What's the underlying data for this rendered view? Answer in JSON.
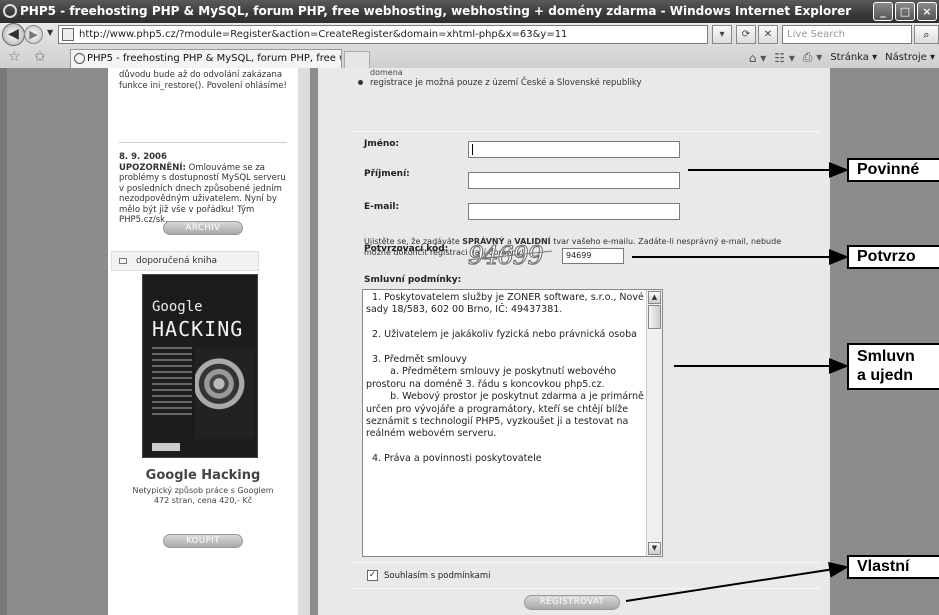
{
  "window": {
    "title": "PHP5 - freehosting PHP & MySQL, forum PHP, free webhosting, webhosting + domény zdarma - Windows Internet Explorer",
    "controls": [
      "_",
      "□",
      "×"
    ]
  },
  "navbar": {
    "url": "http://www.php5.cz/?module=Register&action=CreateRegister&domain=xhtml-php&x=63&y=11",
    "search_placeholder": "Live Search",
    "tab_title": "PHP5 - freehosting PHP & MySQL, forum PHP, free we...",
    "commands": {
      "home": "⌂ ▾",
      "feeds": "☷ ▾",
      "print": "⎙ ▾",
      "page": "Stránka ▾",
      "tools": "Nástroje ▾"
    }
  },
  "sidebar": {
    "top_text": "důvodu bude až do odvolání zakázana funkce ini_restore(). Povolení ohlásíme!",
    "news_date": "8. 9. 2006",
    "news_strong": "UPOZORNĚNÍ:",
    "news_text": " Omlouváme se za problémy s dostupností MySQL serveru v posledních dnech způsobené jedním nezodpovědným uživatelem. Nyní by mělo být již vše v pořádku! Tým PHP5.cz/sk.",
    "archive_button": "ARCHIV",
    "recommended_heading": "doporučená kniha",
    "book_cover_line1": "Google",
    "book_cover_line2": "HACKING",
    "book_title": "Google Hacking",
    "book_desc_line1": "Netypický způsob práce s Googlem",
    "book_desc_line2": "472 stran, cena 420,- Kč",
    "buy_button": "KOUPIT"
  },
  "form": {
    "top_fragment": "domena",
    "bullet": "registrace je možná pouze z území České a Slovenské republiky",
    "name_label": "Jméno:",
    "name_value": "",
    "surname_label": "Příjmení:",
    "surname_value": "",
    "email_label": "E-mail:",
    "email_value": "",
    "note_1": "Ujistěte se, že zadáváte ",
    "note_strong1": "SPRÁVNÝ",
    "note_2": " a ",
    "note_strong2": "VALIDNÍ",
    "note_3": " tvar vašeho e-mailu. Zadáte-li nesprávný e-mail, nebude možné dokončit registraci vaší domény!",
    "captcha_label": "Potvrzovací kód:",
    "captcha_image_text": "94699",
    "captcha_value": "94699",
    "terms_label": "Smluvní podmínky:",
    "terms_text": "  1. Poskytovatelem služby je ZONER software, s.r.o., Nové sady 18/583, 602 00 Brno, IČ: 49437381.\n\n  2. Uživatelem je jakákoliv fyzická nebo právnická osoba\n\n  3. Předmět smlouvy\n        a. Předmětem smlouvy je poskytnutí webového prostoru na doméně 3. řádu s koncovkou php5.cz.\n        b. Webový prostor je poskytnut zdarma a je primárně určen pro vývojáře a programátory, kteří se chtějí blíže seznámit s technologií PHP5, vyzkoušet ji a testovat na reálném webovém serveru.\n\n  4. Práva a povinnosti poskytovatele",
    "agree_checked": true,
    "agree_label": "Souhlasím s podmínkami",
    "register_button": "REGISTROVAT"
  },
  "callouts": {
    "required": "Povinné",
    "confirm": "Potvrzo",
    "terms_line1": "Smluvn",
    "terms_line2": "a ujedn",
    "own": "Vlastní"
  }
}
